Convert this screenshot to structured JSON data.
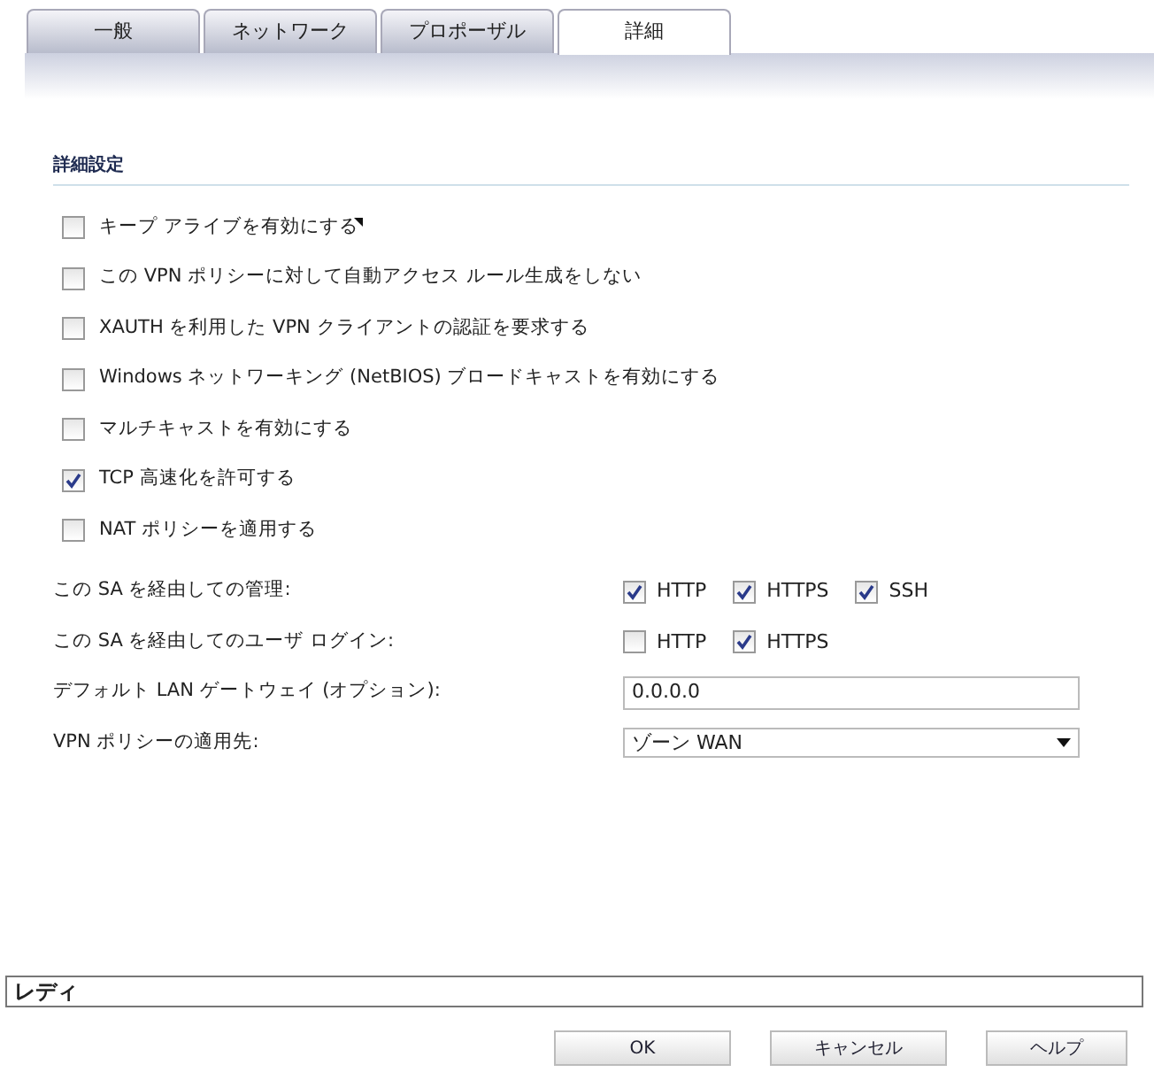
{
  "tabs": [
    {
      "label": "一般",
      "selected": false
    },
    {
      "label": "ネットワーク",
      "selected": false
    },
    {
      "label": "プロポーザル",
      "selected": false
    },
    {
      "label": "詳細",
      "selected": true
    }
  ],
  "section_title": "詳細設定",
  "options": [
    {
      "label": "キープ アライブを有効にする",
      "checked": false
    },
    {
      "label": "この VPN ポリシーに対して自動アクセス ルール生成をしない",
      "checked": false
    },
    {
      "label": "XAUTH を利用した VPN クライアントの認証を要求する",
      "checked": false
    },
    {
      "label": "Windows ネットワーキング (NetBIOS) ブロードキャストを有効にする",
      "checked": false
    },
    {
      "label": "マルチキャストを有効にする",
      "checked": false
    },
    {
      "label": "TCP 高速化を許可する",
      "checked": true
    },
    {
      "label": "NAT ポリシーを適用する",
      "checked": false
    }
  ],
  "form": [
    {
      "kind": "checks",
      "label": "この SA を経由しての管理:",
      "choices": [
        {
          "label": "HTTP",
          "checked": true
        },
        {
          "label": "HTTPS",
          "checked": true
        },
        {
          "label": "SSH",
          "checked": true
        }
      ]
    },
    {
      "kind": "checks",
      "label": "この SA を経由してのユーザ ログイン:",
      "choices": [
        {
          "label": "HTTP",
          "checked": false
        },
        {
          "label": "HTTPS",
          "checked": true
        }
      ]
    },
    {
      "kind": "text",
      "label": "デフォルト LAN ゲートウェイ (オプション):",
      "value": "0.0.0.0"
    },
    {
      "kind": "select",
      "label": "VPN ポリシーの適用先:",
      "value": "ゾーン WAN"
    }
  ],
  "status_bar": "レディ",
  "buttons": [
    "OK",
    "キャンセル",
    "ヘルプ"
  ]
}
